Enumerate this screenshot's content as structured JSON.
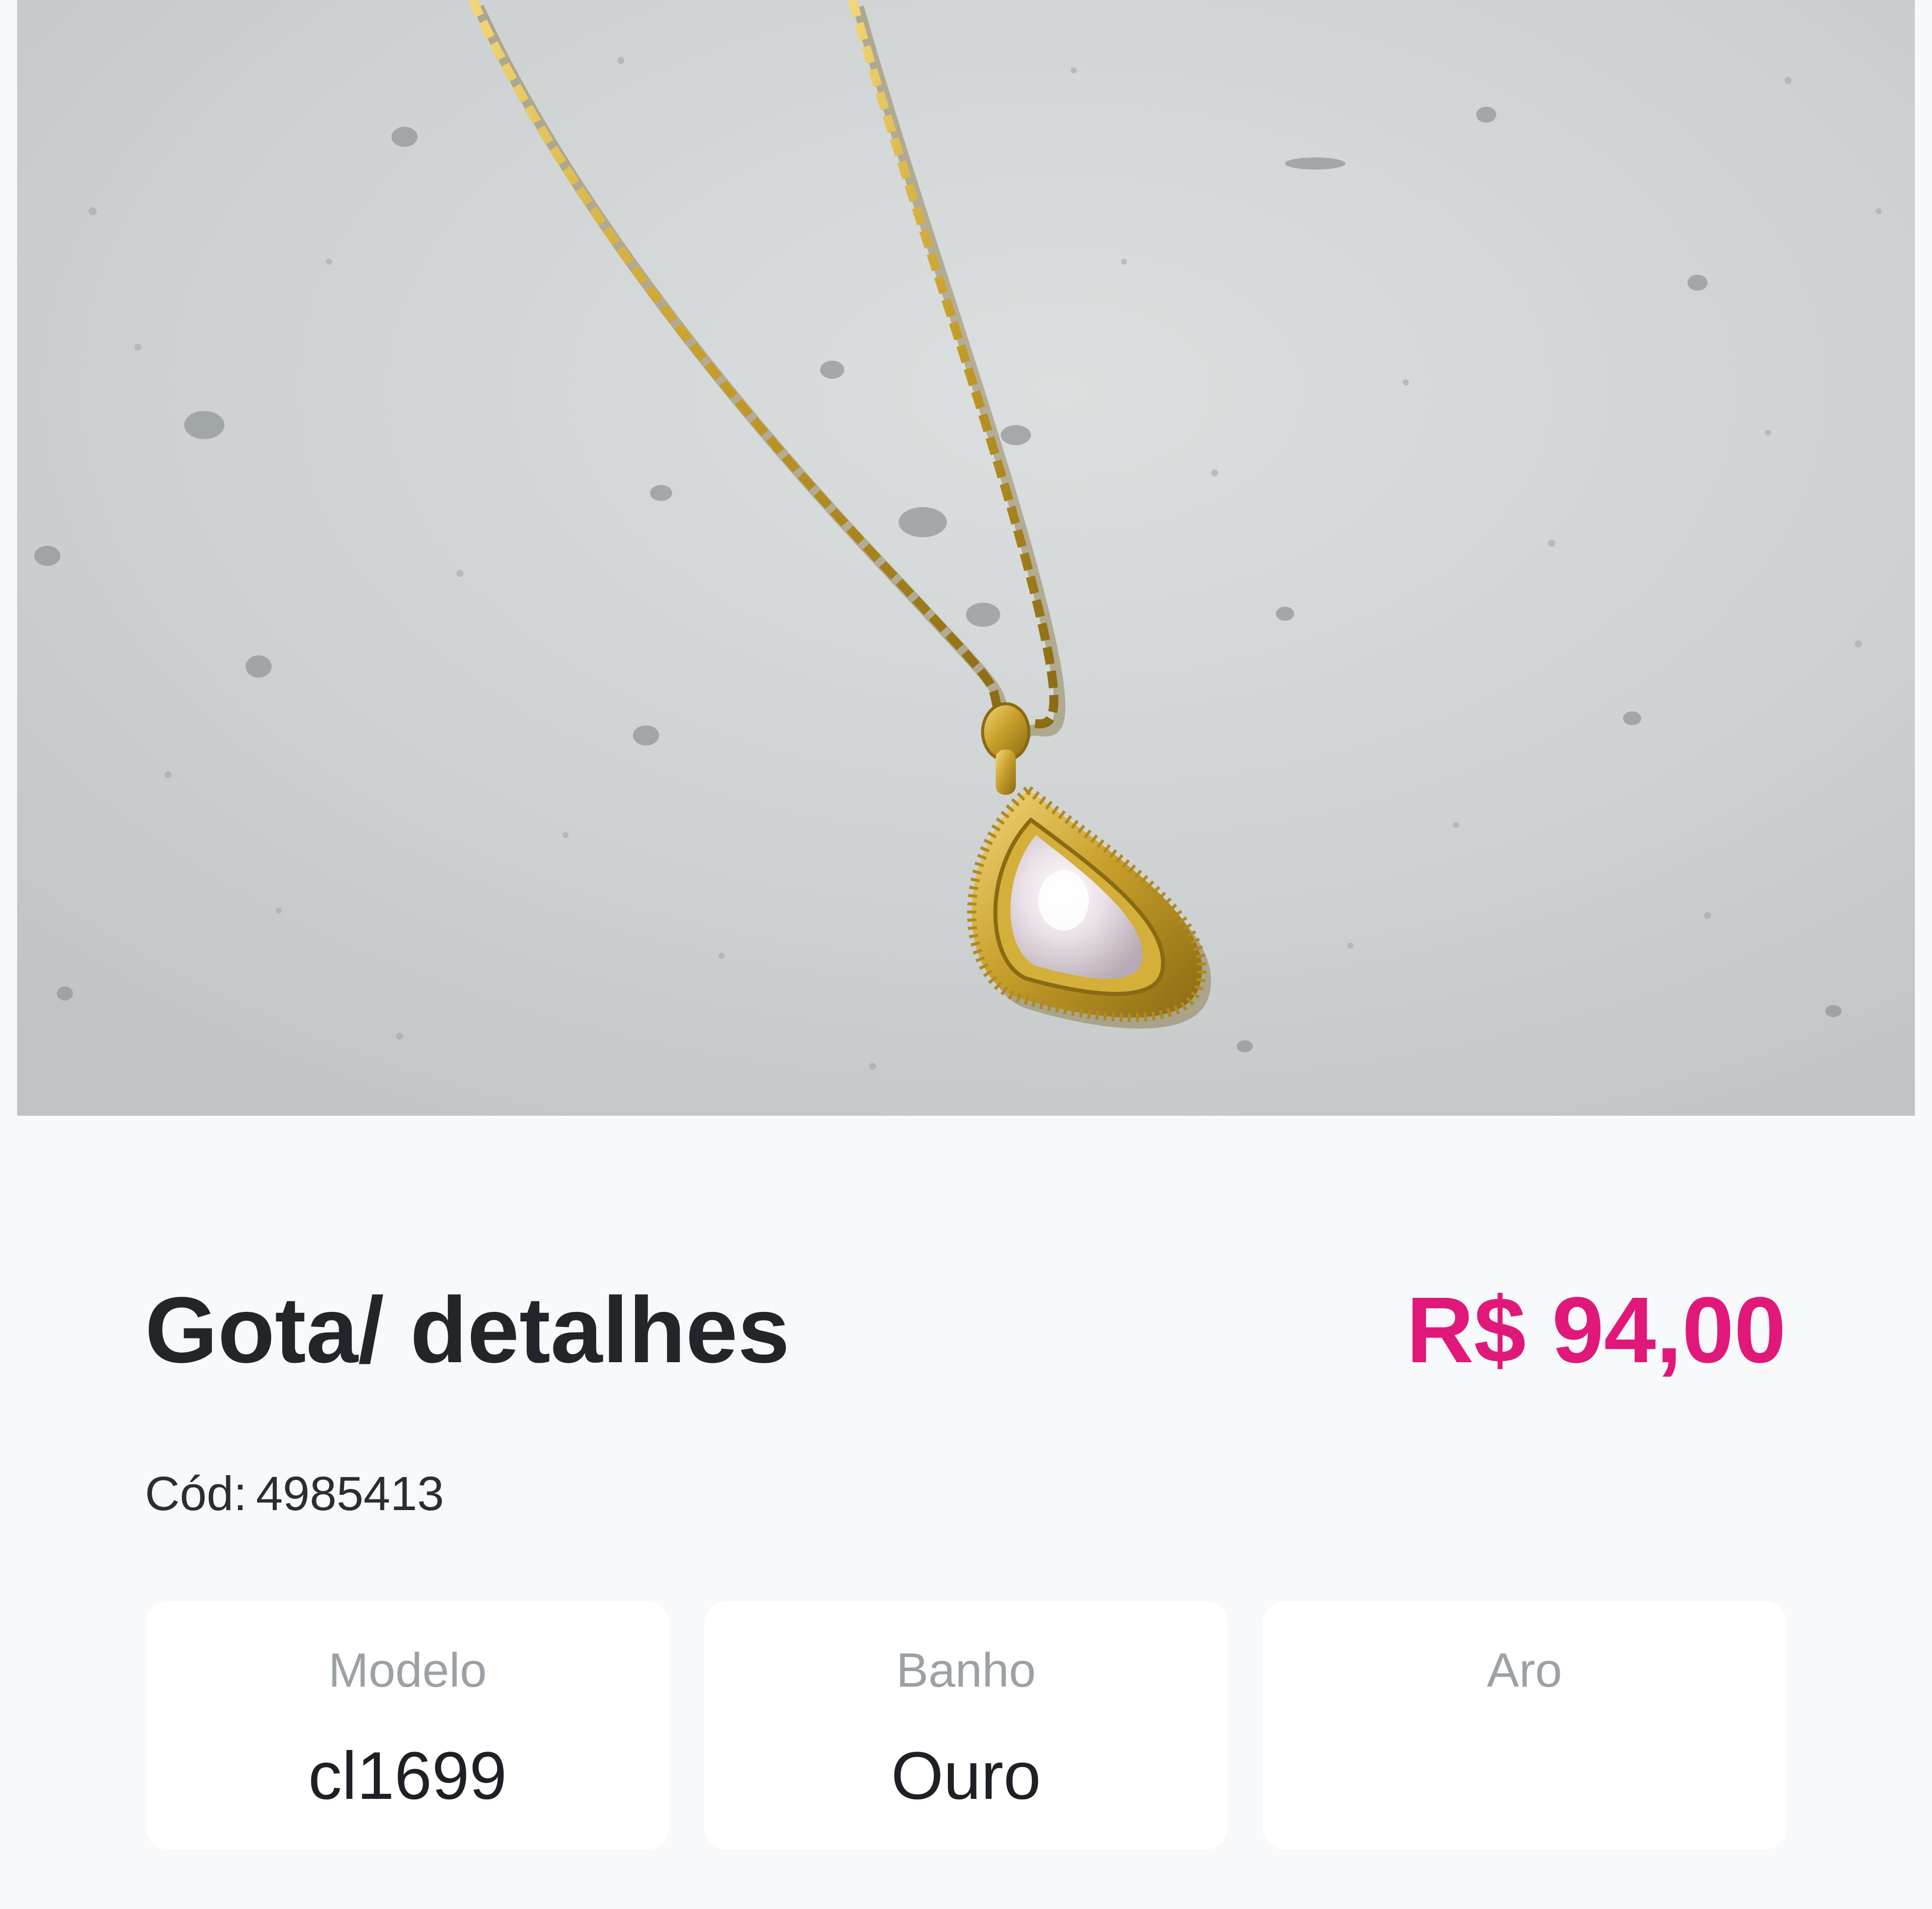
{
  "product": {
    "image_alt": "Colar dourado com pingente de gota",
    "title": "Gota/ detalhes",
    "price": "R$ 94,00",
    "code_label": "Cód:",
    "code_value": "4985413"
  },
  "attributes": [
    {
      "label": "Modelo",
      "value": "cl1699"
    },
    {
      "label": "Banho",
      "value": "Ouro"
    },
    {
      "label": "Aro",
      "value": ""
    }
  ],
  "colors": {
    "accent": "#e0187a",
    "background": "#f8f9fa",
    "card": "#ffffff",
    "title": "#222529",
    "muted": "#9ca1a6"
  },
  "icons": {
    "product_photo": "necklace-photo"
  }
}
